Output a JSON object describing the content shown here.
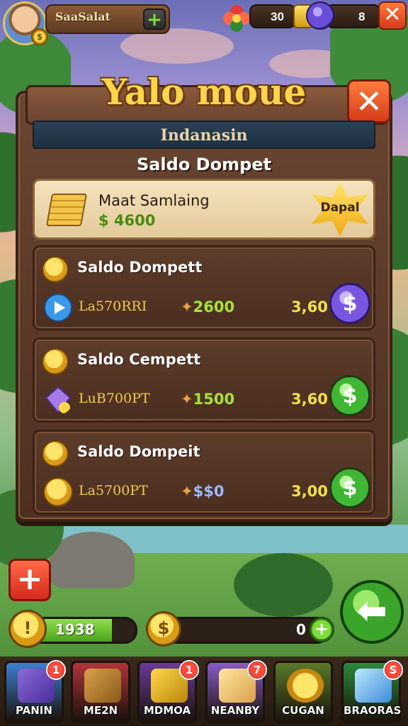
{
  "player": {
    "name": "SaaSalat",
    "avatar_badge": "$"
  },
  "resources": {
    "flower_value": "30",
    "gem_value": "8"
  },
  "dialog": {
    "title": "Yalo moue",
    "subtitle": "Indanasin",
    "section_title": "Saldo Dompet",
    "featured": {
      "name": "Maat Samlaing",
      "price": "$ 4600",
      "badge": "Dapal"
    },
    "offers": [
      {
        "title": "Saldo Dompett",
        "label": "La570RRI",
        "amount": "2600",
        "price": "3,60",
        "button_color": "purple"
      },
      {
        "title": "Saldo Cempett",
        "label": "LuB700PT",
        "amount": "1500",
        "price": "3,60",
        "button_color": "green"
      },
      {
        "title": "Saldo Dompeit",
        "label": "La5700PT",
        "amount": "$$0",
        "price": "3,00",
        "button_color": "green"
      }
    ]
  },
  "hud": {
    "coin_value": "1938",
    "coin_progress": 0.78,
    "wallet_value": "0"
  },
  "nav": [
    {
      "label": "PANIN",
      "badge": "1",
      "color": "#3b7fd0"
    },
    {
      "label": "ME2N",
      "badge": "",
      "color": "#b0343a"
    },
    {
      "label": "MDMOA",
      "badge": "1",
      "color": "#6a3a9a"
    },
    {
      "label": "NEANBY",
      "badge": "7",
      "color": "#8a5ac8"
    },
    {
      "label": "CUGAN",
      "badge": "",
      "color": "#5a7a2a"
    },
    {
      "label": "BRAORAS",
      "badge": "S",
      "color": "#2a8a3a"
    }
  ],
  "colors": {
    "title_gold": "#ffd54a",
    "price_green": "#a6e23a",
    "close_orange": "#d6391c"
  }
}
